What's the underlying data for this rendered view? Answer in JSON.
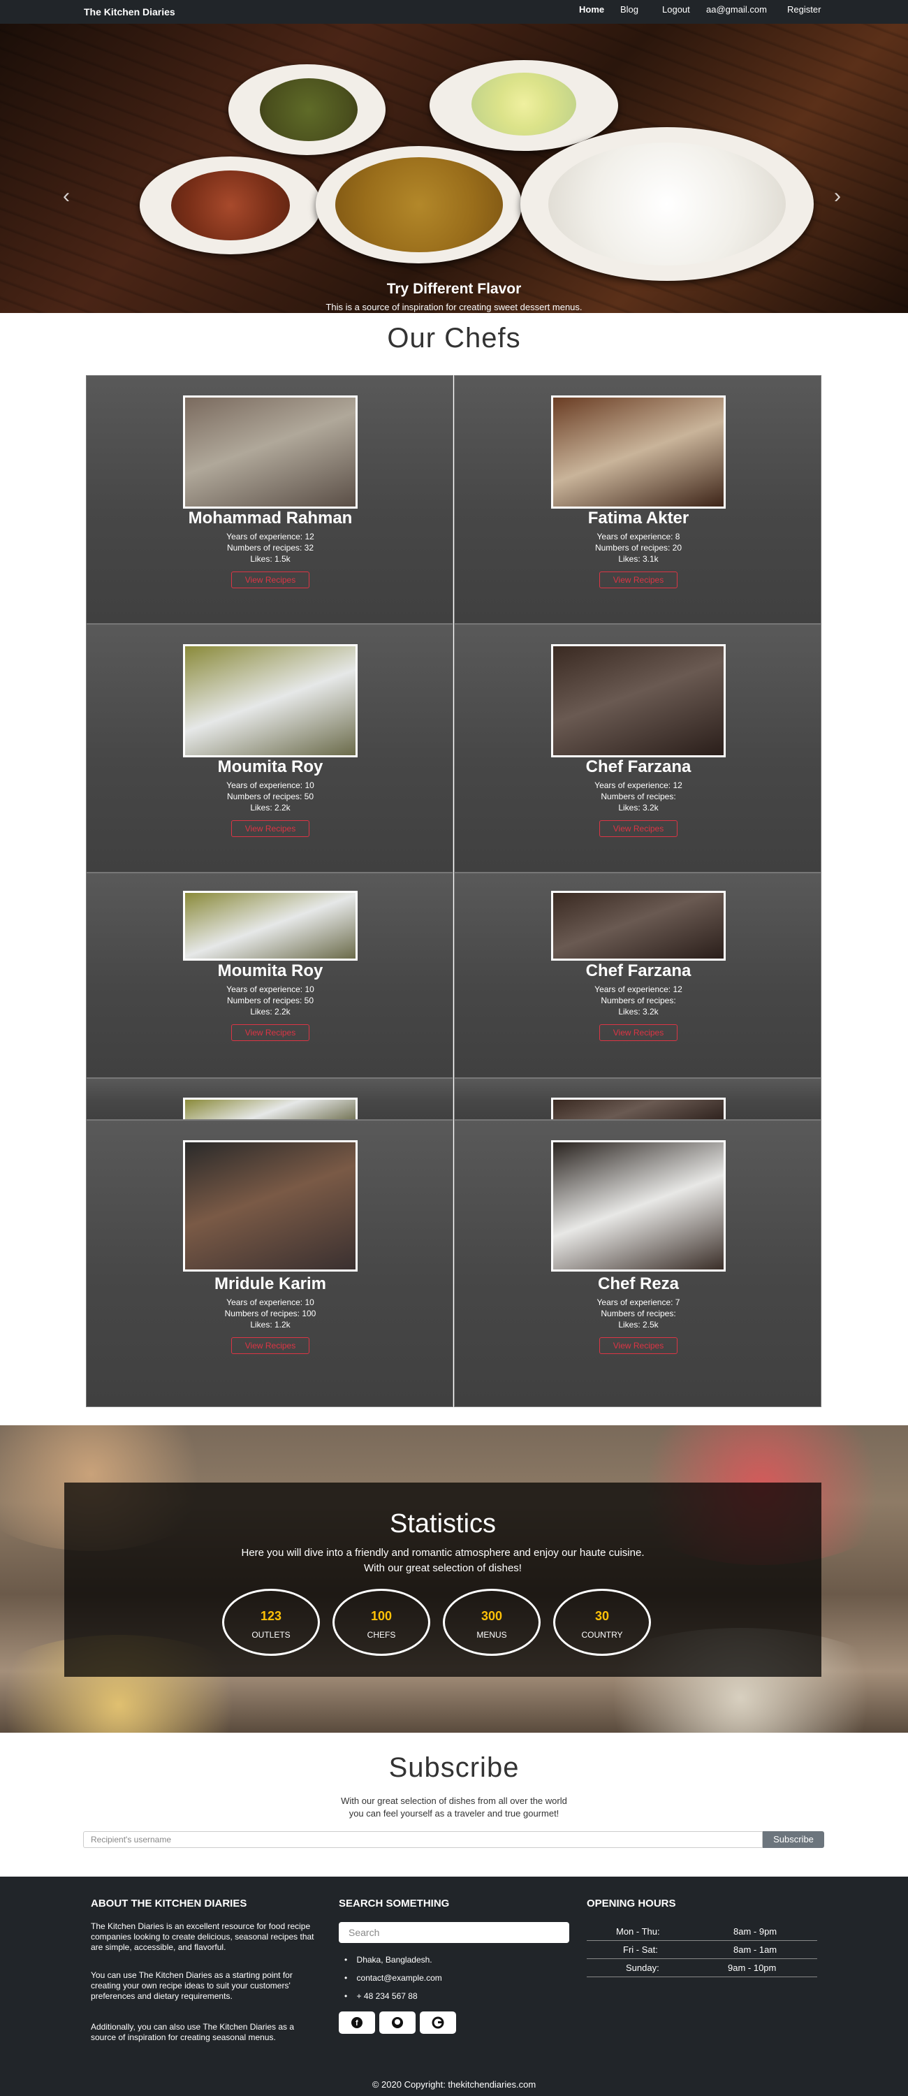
{
  "nav": {
    "brand": "The Kitchen Diaries",
    "home": "Home",
    "blog": "Blog",
    "logout": "Logout",
    "email": "aa@gmail.com",
    "register": "Register"
  },
  "hero": {
    "title": "Try Different Flavor",
    "text": "This is a source of inspiration for creating sweet dessert menus.",
    "prev_icon": "‹",
    "next_icon": "›",
    "slides": 3,
    "active_slide": 2
  },
  "chefs": {
    "title": "Our Chefs",
    "button_label": "View Recipes",
    "items": [
      {
        "name": "Mohammad Rahman",
        "experience": "Years of experience: 12",
        "recipes": "Numbers of recipes: 32",
        "likes": "Likes: 1.5k"
      },
      {
        "name": "Fatima Akter",
        "experience": "Years of experience: 8",
        "recipes": "Numbers of recipes: 20",
        "likes": "Likes: 3.1k"
      },
      {
        "name": "Moumita Roy",
        "experience": "Years of experience: 10",
        "recipes": "Numbers of recipes: 50",
        "likes": "Likes: 2.2k"
      },
      {
        "name": "Chef Farzana",
        "experience": "Years of experience: 12",
        "recipes": "Numbers of recipes:",
        "likes": "Likes: 3.2k"
      },
      {
        "name": "Moumita Roy",
        "experience": "Years of experience: 10",
        "recipes": "Numbers of recipes: 50",
        "likes": "Likes: 2.2k"
      },
      {
        "name": "Chef Farzana",
        "experience": "Years of experience: 12",
        "recipes": "Numbers of recipes:",
        "likes": "Likes: 3.2k"
      },
      {
        "name": "Mridule Karim",
        "experience": "Years of experience: 10",
        "recipes": "Numbers of recipes: 100",
        "likes": "Likes: 1.2k"
      },
      {
        "name": "Chef Reza",
        "experience": "Years of experience: 7",
        "recipes": "Numbers of recipes:",
        "likes": "Likes: 2.5k"
      }
    ]
  },
  "stats": {
    "title": "Statistics",
    "line1": "Here you will dive into a friendly and romantic atmosphere and enjoy our haute cuisine.",
    "line2": "With our great selection of dishes!",
    "items": [
      {
        "value": "123",
        "label": "OUTLETS"
      },
      {
        "value": "100",
        "label": "CHEFS"
      },
      {
        "value": "300",
        "label": "MENUS"
      },
      {
        "value": "30",
        "label": "COUNTRY"
      }
    ]
  },
  "subscribe": {
    "title": "Subscribe",
    "line1": "With our great selection of dishes from all over the world",
    "line2": "you can feel yourself as a traveler and true gourmet!",
    "placeholder": "Recipient's username",
    "button": "Subscribe"
  },
  "footer": {
    "about_title": "ABOUT THE KITCHEN DIARIES",
    "about_p1": "The Kitchen Diaries is an excellent resource for food recipe companies looking to create delicious, seasonal recipes that are simple, accessible, and flavorful.",
    "about_p2": "You can use The Kitchen Diaries as a starting point for creating your own recipe ideas to suit your customers' preferences and dietary requirements.",
    "about_p3": "Additionally, you can also use The Kitchen Diaries as a source of inspiration for creating seasonal menus.",
    "search_title": "SEARCH SOMETHING",
    "search_placeholder": "Search",
    "address": "Dhaka, Bangladesh.",
    "email": "contact@example.com",
    "phone": "+ 48 234 567 88",
    "hours_title": "OPENING HOURS",
    "hours": [
      {
        "day": "Mon - Thu:",
        "time": "8am - 9pm"
      },
      {
        "day": "Fri - Sat:",
        "time": "8am - 1am"
      },
      {
        "day": "Sunday:",
        "time": "9am - 10pm"
      }
    ],
    "social": [
      "facebook-icon",
      "github-icon",
      "google-icon"
    ],
    "copyright": "© 2020 Copyright: thekitchendiaries.com"
  }
}
